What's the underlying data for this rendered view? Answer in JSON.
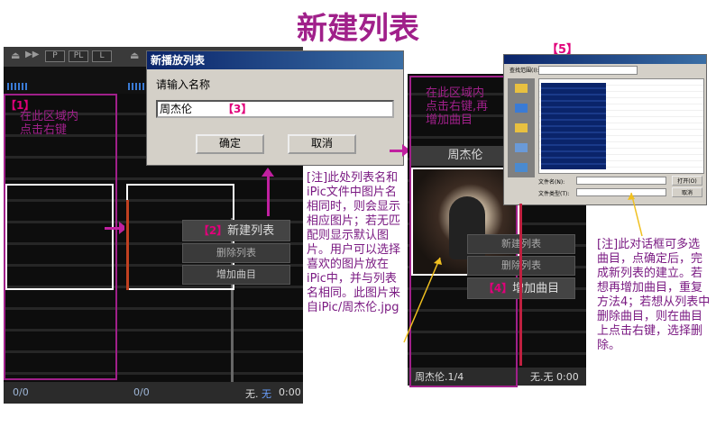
{
  "page_title": "新建列表",
  "left_player": {
    "top_buttons": [
      "P",
      "PL",
      "L"
    ],
    "label1": "【1】",
    "annot1": "在此区域内\n点击右键",
    "counter": "0/0"
  },
  "mid_player": {
    "counter": "0/0",
    "status_none": "无.",
    "status_none_blue": "无",
    "time": "0:00",
    "menu_label": "【2】",
    "menu_new": "新建列表",
    "menu_delete": "删除列表",
    "menu_add": "增加曲目"
  },
  "dialog": {
    "title": "新播放列表",
    "prompt": "请输入名称",
    "input_value": "周杰伦",
    "label3": "【3】",
    "ok": "确定",
    "cancel": "取消"
  },
  "note1": "[注]此处列表名和iPic文件中图片名相同时，则会显示相应图片；若无匹配则显示默认图片。用户可以选择喜欢的图片放在iPic中，并与列表名相同。此图片来自iPic/周杰伦.jpg",
  "right_player": {
    "annot": "在此区域内\n点击右键,再\n增加曲目",
    "playlist_name": "周杰伦",
    "menu_new": "新建列表",
    "menu_delete": "删除列表",
    "label4": "【4】",
    "menu_add": "增加曲目",
    "bottom_left": "周杰伦.1/4",
    "bottom_right": "无.无 0:00"
  },
  "file_dialog": {
    "label5": "【5】",
    "lookin_label": "查找范围(I):",
    "filename_label": "文件名(N):",
    "filetype_label": "文件类型(T):",
    "open_btn": "打开(O)",
    "cancel_btn": "取消"
  },
  "note2": "[注]此对话框可多选曲目，点确定后，完成新列表的建立。若想再增加曲目，重复方法4；若想从列表中删除曲目，则在曲目上点击右键，选择删除。"
}
